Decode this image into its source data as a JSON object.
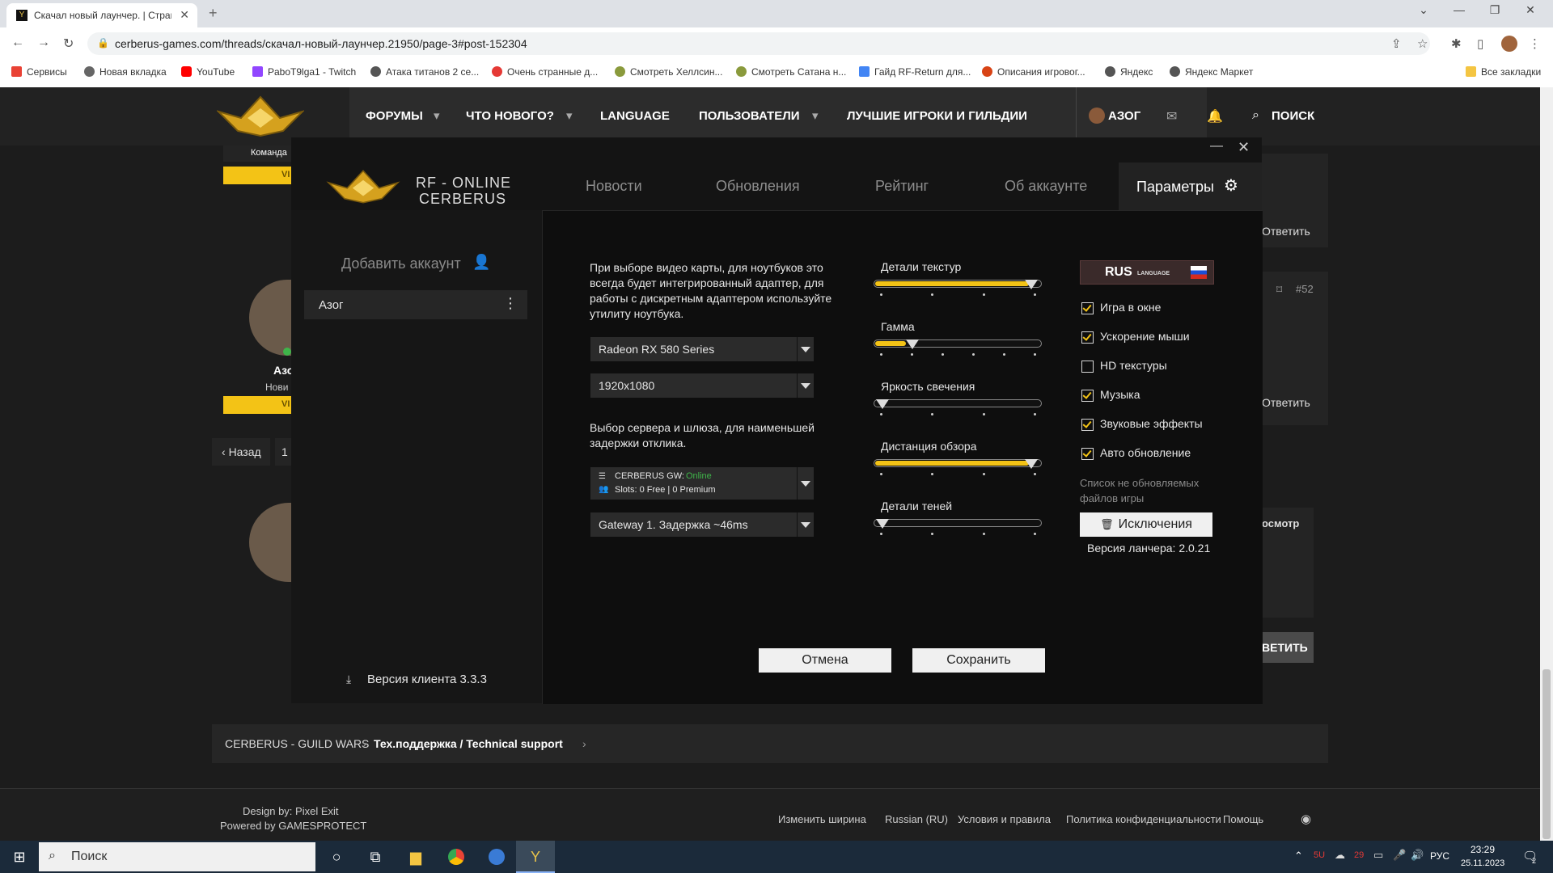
{
  "browser": {
    "tab_title": "Скачал новый лаунчер. | Стран",
    "url": "cerberus-games.com/threads/скачал-новый-лаунчер.21950/page-3#post-152304",
    "bookmarks": [
      "Сервисы",
      "Новая вкладка",
      "YouTube",
      "PaboT9lga1 - Twitch",
      "Атака титанов 2 се...",
      "Очень странные д...",
      "Смотреть Хеллсин...",
      "Смотреть Сатана н...",
      "Гайд RF-Return для...",
      "Описания игровог...",
      "Яндекс",
      "Яндекс Маркет"
    ],
    "bookmarks_all": "Все закладки"
  },
  "forum": {
    "nav": {
      "forums": "ФОРУМЫ",
      "whats_new": "ЧТО НОВОГО?",
      "language": "LANGUAGE",
      "users": "ПОЛЬЗОВАТЕЛИ",
      "best": "ЛУЧШИЕ ИГРОКИ И ГИЛЬДИИ",
      "user": "АЗОГ",
      "search": "ПОИСК"
    },
    "team_label": "Команда",
    "vip": "VI",
    "user_short": "Азо",
    "user_rank": "Нови",
    "reply": "Ответить",
    "post_num": "#52",
    "back": "Назад",
    "page1": "1",
    "preview": "осмотр",
    "reply_big": "ВЕТИТЬ",
    "breadcrumb": {
      "root": "CERBERUS - GUILD WARS",
      "section": "Тех.поддержка / Technical support"
    },
    "footer": {
      "design": "Design by: Pixel Exit",
      "powered": "Powered by GAMESPROTECT",
      "links": [
        "Изменить ширина",
        "Russian (RU)",
        "Условия и правила",
        "Политика конфиденциальности",
        "Помощь"
      ]
    }
  },
  "launcher": {
    "brand_line1": "RF - ONLINE",
    "brand_line2": "CERBERUS",
    "tabs": [
      "Новости",
      "Обновления",
      "Рейтинг",
      "Об аккаунте",
      "Параметры"
    ],
    "add_account": "Добавить аккаунт",
    "account": "Азог",
    "client_version": "Версия клиента 3.3.3",
    "gpu_note": "При выборе видео карты, для ноутбуков это всегда будет интегрированный адаптер, для работы с дискретным адаптером используйте утилиту ноутбука.",
    "gpu": "Radeon RX 580 Series",
    "resolution": "1920x1080",
    "server_note": "Выбор сервера и шлюза, для наименьшей задержки отклика.",
    "server": {
      "name": "CERBERUS GW:",
      "status": "Online",
      "slots": "Slots: 0 Free | 0 Premium"
    },
    "gateway": "Gateway 1. Задержка ~46ms",
    "sliders": [
      {
        "label": "Детали текстур",
        "level": 1.0,
        "steps": 4
      },
      {
        "label": "Гамма",
        "level": 0.2,
        "steps": 6
      },
      {
        "label": "Яркость свечения",
        "level": 0.0,
        "steps": 4
      },
      {
        "label": "Дистанция обзора",
        "level": 1.0,
        "steps": 4
      },
      {
        "label": "Детали теней",
        "level": 0.0,
        "steps": 4
      }
    ],
    "lang": {
      "code": "RUS",
      "word": "LANGUAGE"
    },
    "options": [
      {
        "label": "Игра в окне",
        "checked": true
      },
      {
        "label": "Ускорение мыши",
        "checked": true
      },
      {
        "label": "HD текстуры",
        "checked": false
      },
      {
        "label": "Музыка",
        "checked": true
      },
      {
        "label": "Звуковые эффекты",
        "checked": true
      },
      {
        "label": "Авто обновление",
        "checked": true
      }
    ],
    "exclusions_note": "Список не обновляемых файлов игры",
    "exclusions_btn": "Исключения",
    "launcher_version": "Версия ланчера: 2.0.21",
    "cancel": "Отмена",
    "save": "Сохранить"
  },
  "taskbar": {
    "search": "Поиск",
    "lang": "РУС",
    "time": "23:29",
    "date": "25.11.2023",
    "tray1": "5U",
    "tray2": "29",
    "notif": "2"
  },
  "colors": {
    "accent": "#f3c316",
    "online": "#3fb54a"
  }
}
